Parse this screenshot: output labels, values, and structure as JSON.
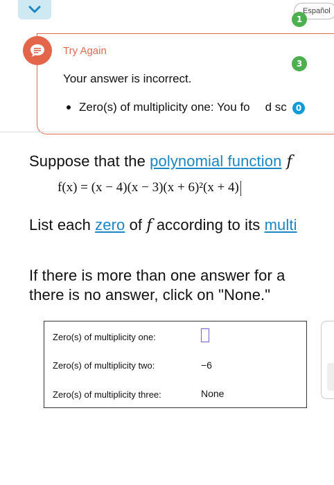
{
  "top": {
    "collapse_icon": "chevron-down-icon",
    "language_label": "Español"
  },
  "badges": {
    "one": "1",
    "three": "3",
    "zero": "0"
  },
  "feedback": {
    "icon": "feedback-icon",
    "title": "Try Again",
    "message": "Your answer is incorrect.",
    "item_pre": "Zero(s) of multiplicity one: You fo",
    "item_post": "d sc"
  },
  "question": {
    "line1_pre": "Suppose that the ",
    "line1_link": "polynomial function",
    "line1_post": " f",
    "equation": "f(x) = (x − 4)(x − 3)(x + 6)²(x + 4)",
    "line2_pre": "List each ",
    "line2_link1": "zero",
    "line2_mid": " of ",
    "line2_var": "f",
    "line2_post": " according to its ",
    "line2_link2": "multi",
    "line3": "If there is more than one answer for a",
    "line4": "there is no answer, click on \"None.\""
  },
  "answers": {
    "rows": [
      {
        "label": "Zero(s) of multiplicity one:",
        "value": ""
      },
      {
        "label": "Zero(s) of multiplicity two:",
        "value": "−6"
      },
      {
        "label": "Zero(s) of multiplicity three:",
        "value": "None"
      }
    ]
  },
  "colors": {
    "accent_blue": "#1a86c4",
    "error_orange": "#e06a4f",
    "badge_green": "#4caf50",
    "badge_blue": "#0f9bd8",
    "input_purple": "#7a5fd6"
  }
}
